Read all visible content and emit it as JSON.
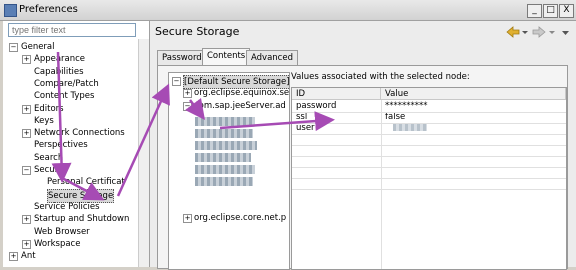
{
  "window": {
    "title": "Preferences"
  },
  "window_controls": [
    "_",
    "□",
    "X"
  ],
  "filter": {
    "placeholder": "type filter text"
  },
  "nav_tree": [
    {
      "label": "General",
      "indent": 0,
      "expander": "−"
    },
    {
      "label": "Appearance",
      "indent": 1,
      "expander": "+"
    },
    {
      "label": "Capabilities",
      "indent": 1,
      "expander": ""
    },
    {
      "label": "Compare/Patch",
      "indent": 1,
      "expander": ""
    },
    {
      "label": "Content Types",
      "indent": 1,
      "expander": ""
    },
    {
      "label": "Editors",
      "indent": 1,
      "expander": "+"
    },
    {
      "label": "Keys",
      "indent": 1,
      "expander": ""
    },
    {
      "label": "Network Connections",
      "indent": 1,
      "expander": "+"
    },
    {
      "label": "Perspectives",
      "indent": 1,
      "expander": ""
    },
    {
      "label": "Search",
      "indent": 1,
      "expander": ""
    },
    {
      "label": "Security",
      "indent": 1,
      "expander": "−"
    },
    {
      "label": "Personal Certificat",
      "indent": 2,
      "expander": ""
    },
    {
      "label": "Secure Storage",
      "indent": 2,
      "expander": "",
      "selected": true
    },
    {
      "label": "Service Policies",
      "indent": 1,
      "expander": ""
    },
    {
      "label": "Startup and Shutdown",
      "indent": 1,
      "expander": "+"
    },
    {
      "label": "Web Browser",
      "indent": 1,
      "expander": ""
    },
    {
      "label": "Workspace",
      "indent": 1,
      "expander": "+"
    },
    {
      "label": "Ant",
      "indent": 0,
      "expander": "+"
    }
  ],
  "page": {
    "title": "Secure Storage"
  },
  "tabs": [
    "Password",
    "Contents",
    "Advanced"
  ],
  "active_tab": "Contents",
  "node_tree": [
    {
      "label": "[Default Secure Storage]",
      "indent": 0,
      "expander": "−",
      "selected": true
    },
    {
      "label": "org.eclipse.equinox.se",
      "indent": 1,
      "expander": "+"
    },
    {
      "label": "com.sap.jeeServer.ad",
      "indent": 1,
      "expander": "−"
    },
    {
      "label": "org.eclipse.core.net.p",
      "indent": 1,
      "expander": "+"
    }
  ],
  "values_label": "Values associated with the selected node:",
  "table": {
    "columns": [
      "ID",
      "Value"
    ],
    "rows": [
      {
        "id": "password",
        "value": "**********"
      },
      {
        "id": "ssl",
        "value": "false"
      },
      {
        "id": "user",
        "value": ""
      }
    ]
  }
}
